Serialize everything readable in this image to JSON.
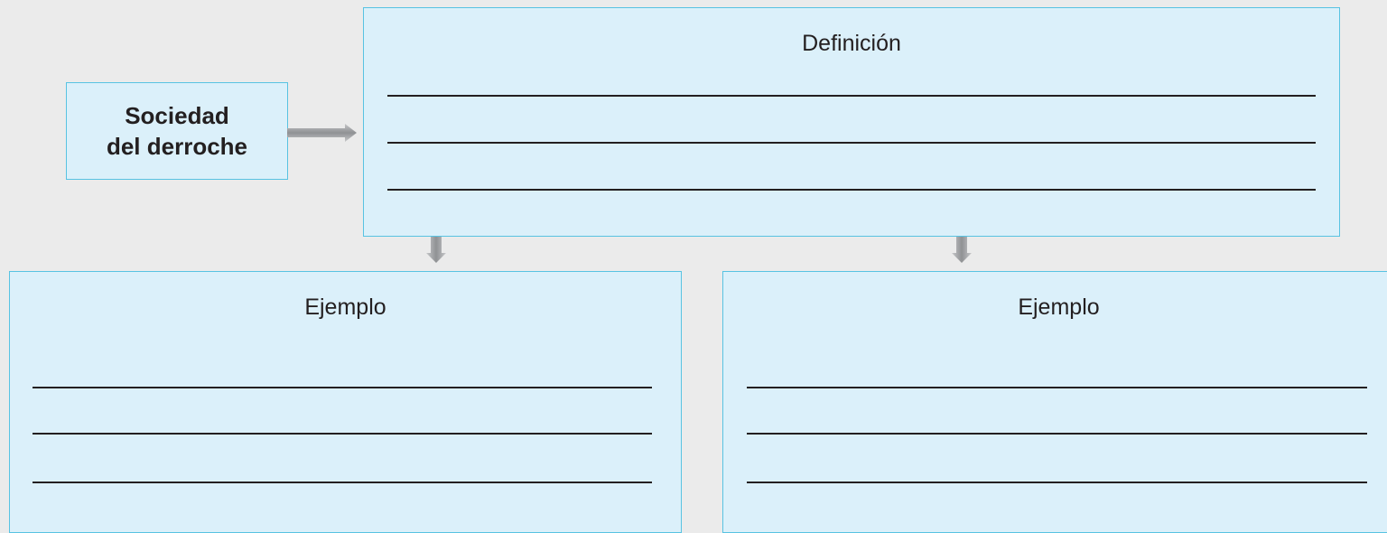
{
  "concept": {
    "label": "Sociedad\ndel derroche"
  },
  "definition": {
    "heading": "Definición",
    "answer_lines": 3
  },
  "examples": [
    {
      "heading": "Ejemplo",
      "answer_lines": 3
    },
    {
      "heading": "Ejemplo",
      "answer_lines": 3
    }
  ],
  "colors": {
    "box_fill": "#dbf0fa",
    "box_border": "#58c3e2",
    "arrow": "#a7a9ac",
    "text": "#231f20",
    "background": "#ebebeb"
  }
}
